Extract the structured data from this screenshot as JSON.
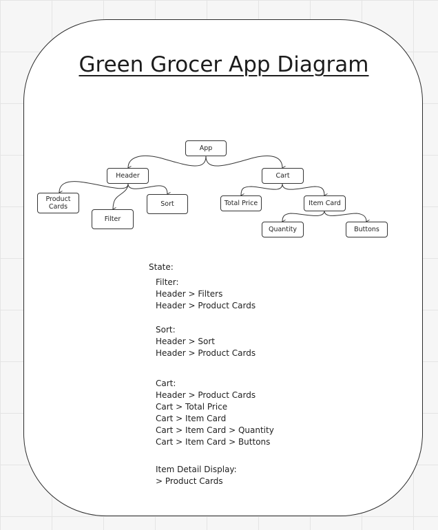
{
  "title": "Green Grocer App Diagram",
  "nodes": {
    "app": "App",
    "header": "Header",
    "cart": "Cart",
    "product_cards_line1": "Product",
    "product_cards_line2": "Cards",
    "filter": "Filter",
    "sort": "Sort",
    "total_price": "Total Price",
    "item_card": "Item Card",
    "quantity": "Quantity",
    "buttons": "Buttons"
  },
  "state": {
    "heading": "State:",
    "filter": {
      "label": "Filter:",
      "lines": [
        "Header > Filters",
        "Header > Product Cards"
      ]
    },
    "sort": {
      "label": "Sort:",
      "lines": [
        "Header > Sort",
        "Header > Product Cards"
      ]
    },
    "cart": {
      "label": "Cart:",
      "lines": [
        "Header > Product Cards",
        "Cart > Total Price",
        "Cart > Item Card",
        "Cart > Item Card > Quantity",
        "Cart > Item Card > Buttons"
      ]
    },
    "item_detail": {
      "label": "Item Detail Display:",
      "lines": [
        "> Product Cards"
      ]
    }
  }
}
